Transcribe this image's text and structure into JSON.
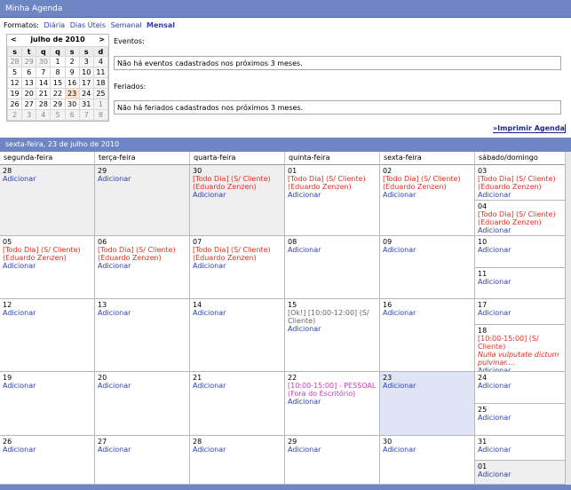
{
  "window": {
    "title": "Minha Agenda"
  },
  "formats": {
    "label": "Formatos:",
    "items": [
      "Diária",
      "Dias Úteis",
      "Semanal",
      "Mensal"
    ]
  },
  "mini_cal": {
    "title": "julho de 2010",
    "prev": "<",
    "next": ">",
    "dow": [
      "s",
      "t",
      "q",
      "q",
      "s",
      "s",
      "d"
    ],
    "weeks": [
      [
        "28",
        "29",
        "30",
        "1",
        "2",
        "3",
        "4"
      ],
      [
        "5",
        "6",
        "7",
        "8",
        "9",
        "10",
        "11"
      ],
      [
        "12",
        "13",
        "14",
        "15",
        "16",
        "17",
        "18"
      ],
      [
        "19",
        "20",
        "21",
        "22",
        "23",
        "24",
        "25"
      ],
      [
        "26",
        "27",
        "28",
        "29",
        "30",
        "31",
        "1"
      ],
      [
        "2",
        "3",
        "4",
        "5",
        "6",
        "7",
        "8"
      ]
    ]
  },
  "events": {
    "label": "Eventos:",
    "message": "Não há eventos cadastrados nos próximos 3 meses."
  },
  "holidays": {
    "label": "Feriados:",
    "message": "Não há feriados cadastrados nos próximos 3 meses."
  },
  "print_label": "»Imprimir Agenda",
  "current_date": "sexta-feira, 23 de julho de 2010",
  "weekdays": [
    "segunda-feira",
    "terça-feira",
    "quarta-feira",
    "quinta-feira",
    "sexta-feira",
    "sábado/domingo"
  ],
  "add_label": "Adicionar",
  "event_todo": "[Todo Dia] (S/ Cliente) (Eduardo Zenzen)",
  "event_ok": "[Ok!] [10:00-12:00] (S/ Cliente)",
  "event_pessoal": "[10:00-15:00] - PESSOAL (Fora do Escritório)",
  "event_18_a": "[10:00-15:00] (S/ Cliente) ",
  "event_18_b": "Nulla vulputate dictum pulvinar....",
  "weeks": [
    {
      "days": [
        "28",
        "29",
        "30",
        "01",
        "02"
      ],
      "sat": "03",
      "sun": "04"
    },
    {
      "days": [
        "05",
        "06",
        "07",
        "08",
        "09"
      ],
      "sat": "10",
      "sun": "11"
    },
    {
      "days": [
        "12",
        "13",
        "14",
        "15",
        "16"
      ],
      "sat": "17",
      "sun": "18"
    },
    {
      "days": [
        "19",
        "20",
        "21",
        "22",
        "23"
      ],
      "sat": "24",
      "sun": "25"
    },
    {
      "days": [
        "26",
        "27",
        "28",
        "29",
        "30"
      ],
      "sat": "31",
      "sun": "01"
    }
  ]
}
